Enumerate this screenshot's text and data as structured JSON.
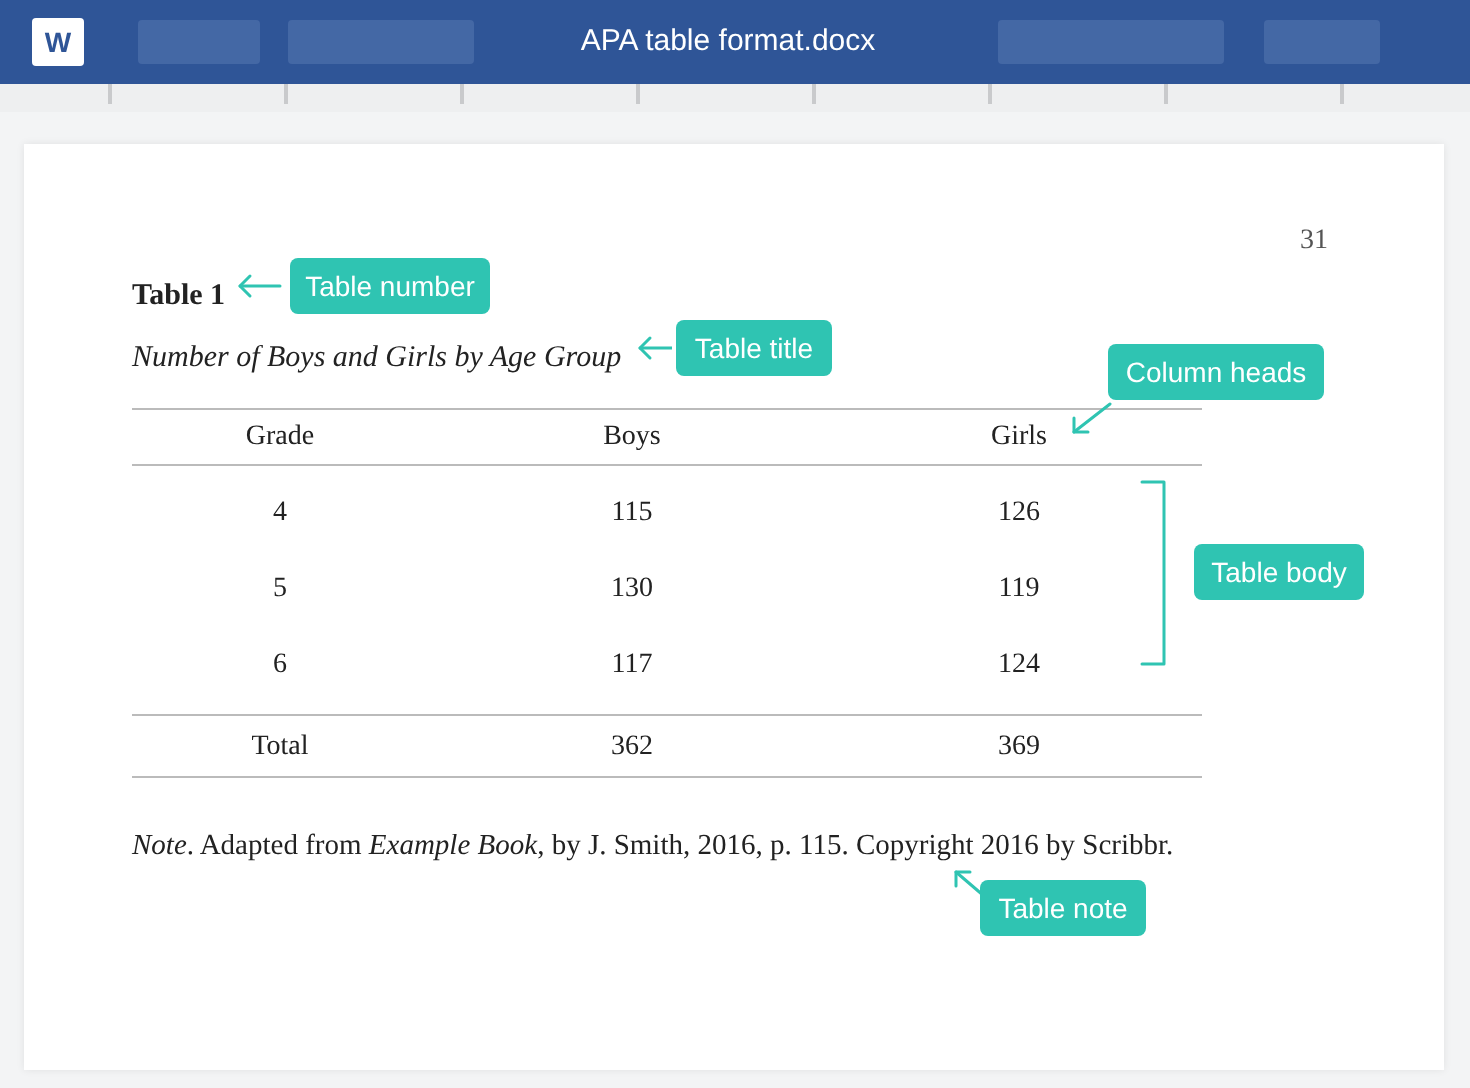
{
  "window": {
    "title": "APA table format.docx",
    "app_icon_letter": "W"
  },
  "page": {
    "page_number": "31",
    "table_label": "Table 1",
    "table_title": "Number of Boys and Girls by Age Group",
    "columns": [
      "Grade",
      "Boys",
      "Girls"
    ],
    "rows": [
      [
        "4",
        "115",
        "126"
      ],
      [
        "5",
        "130",
        "119"
      ],
      [
        "6",
        "117",
        "124"
      ]
    ],
    "total_row": [
      "Total",
      "362",
      "369"
    ],
    "note": "*Note*. Adapted from *Example Book*, by J. Smith, 2016, p. 115. Copyright 2016 by Scribbr."
  },
  "callouts": [
    {
      "text": "Table number",
      "kind": "arrow-left"
    },
    {
      "text": "Table title",
      "kind": "arrow-left"
    },
    {
      "text": "Column heads",
      "kind": "arrow-down-left"
    },
    {
      "text": "Table body",
      "kind": "bracket"
    },
    {
      "text": "Table note",
      "kind": "arrow-up-left"
    }
  ]
}
